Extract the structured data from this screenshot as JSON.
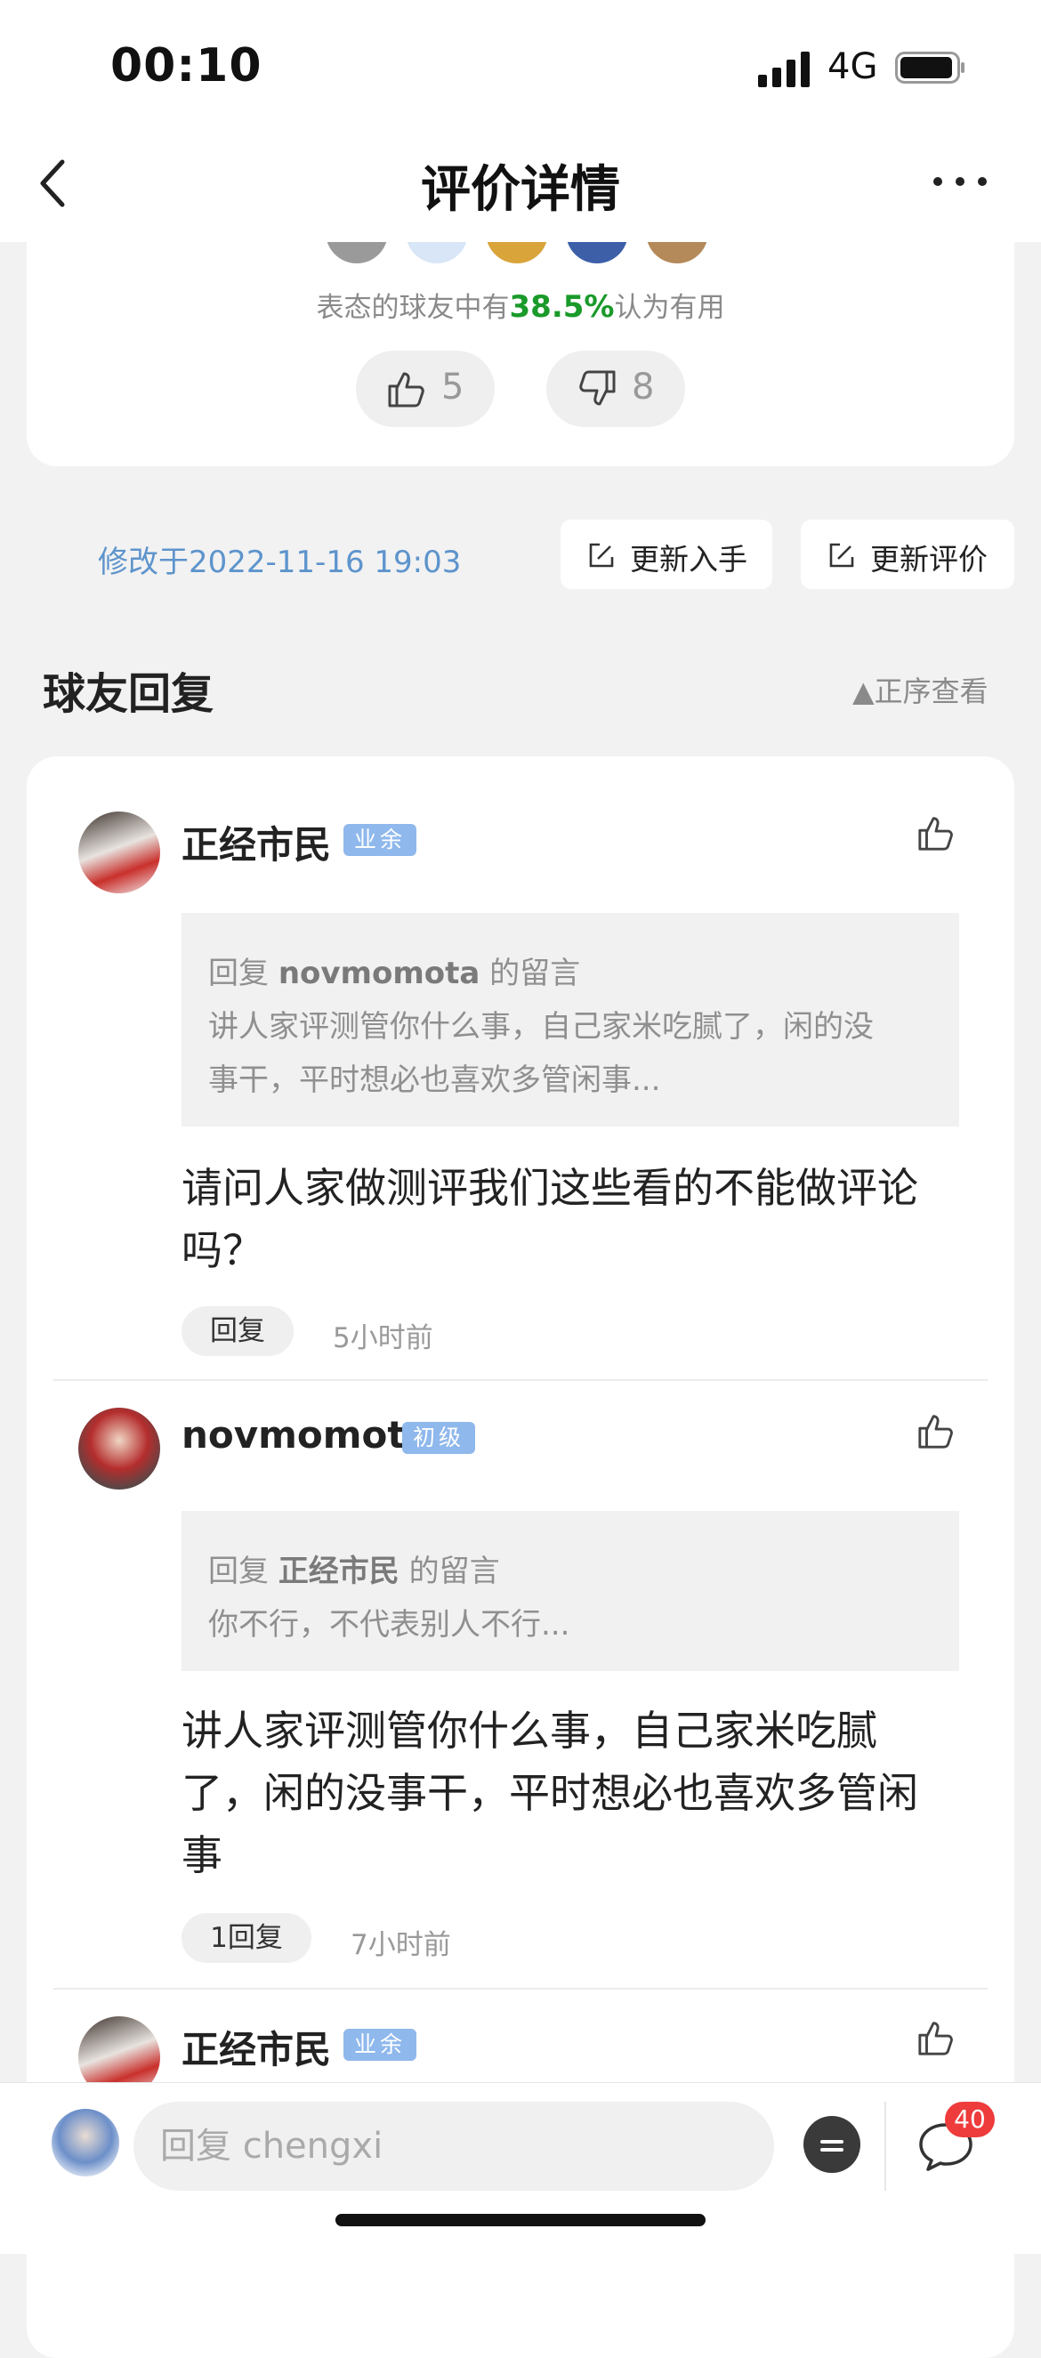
{
  "status": {
    "time": "00:10",
    "network": "4G"
  },
  "nav": {
    "title": "评价详情"
  },
  "rating": {
    "prefix": "表态的球友中有",
    "percent": "38.5%",
    "suffix": "认为有用",
    "up": "5",
    "down": "8"
  },
  "meta": {
    "modified": "修改于2022-11-16 19:03",
    "update_buy": "更新入手",
    "update_review": "更新评价"
  },
  "section": {
    "title": "球友回复",
    "sort": "▲正序查看"
  },
  "comments": [
    {
      "user": "正经市民",
      "badge": "业余",
      "quote_prefix": "回复",
      "quote_user": "novmomota",
      "quote_suffix": "的留言",
      "quote_lines": [
        "讲人家评测管你什么事，自己家米吃腻了，闲的没",
        "事干，平时想必也喜欢多管闲事..."
      ],
      "text_lines": [
        "请问人家做测评我们这些看的不能做评论",
        "吗？"
      ],
      "reply": "回复",
      "time": "5小时前"
    },
    {
      "user": "novmomota",
      "badge": "初级",
      "quote_prefix": "回复",
      "quote_user": "正经市民",
      "quote_suffix": "的留言",
      "quote_lines": [
        "你不行，不代表别人不行..."
      ],
      "text_lines": [
        "讲人家评测管你什么事，自己家米吃腻",
        "了，闲的没事干，平时想必也喜欢多管闲",
        "事"
      ],
      "reply": "1回复",
      "time": "7小时前"
    },
    {
      "user": "正经市民",
      "badge": "业余"
    }
  ],
  "bottom": {
    "placeholder": "回复 chengxi",
    "count": "40"
  },
  "icons": [
    "back-icon",
    "more-icon",
    "thumbs-up-icon",
    "thumbs-down-icon",
    "edit-icon",
    "like-icon",
    "emoji-icon",
    "comment-icon"
  ],
  "colors": {
    "accent_green": "#1a9a2a",
    "link_blue": "#5d94cc",
    "badge_blue": "#8fb8ec",
    "notify_red": "#ee3b3b"
  }
}
